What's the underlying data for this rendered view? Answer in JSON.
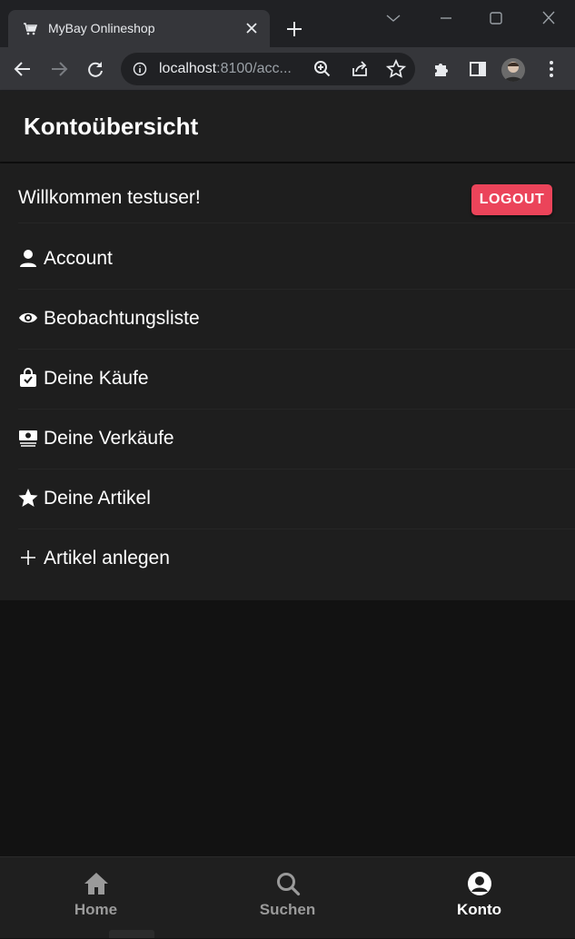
{
  "browser": {
    "tab_title": "MyBay Onlineshop",
    "url_host": "localhost",
    "url_rest": ":8100/acc...",
    "icons": [
      "cart-icon",
      "close-icon",
      "plus-icon",
      "back-icon",
      "forward-icon",
      "reload-icon",
      "info-icon",
      "zoom-icon",
      "share-icon",
      "star-icon",
      "puzzle-icon",
      "sidepanel-icon",
      "menu-dots-icon"
    ]
  },
  "header": {
    "title": "Kontoübersicht"
  },
  "welcome": {
    "text": "Willkommen testuser!",
    "logout_label": "LOGOUT"
  },
  "menu": {
    "items": [
      {
        "label": "Account",
        "icon": "person-icon"
      },
      {
        "label": "Beobachtungsliste",
        "icon": "eye-icon"
      },
      {
        "label": "Deine Käufe",
        "icon": "bag-check-icon"
      },
      {
        "label": "Deine Verkäufe",
        "icon": "cash-icon"
      },
      {
        "label": "Deine Artikel",
        "icon": "star-icon"
      },
      {
        "label": "Artikel anlegen",
        "icon": "add-icon"
      }
    ]
  },
  "tabbar": {
    "tabs": [
      {
        "label": "Home",
        "icon": "home-icon",
        "active": false
      },
      {
        "label": "Suchen",
        "icon": "search-icon",
        "active": false
      },
      {
        "label": "Konto",
        "icon": "person-circle-icon",
        "active": true
      }
    ]
  },
  "colors": {
    "accent": "#eb445a",
    "background": "#121212",
    "surface": "#1e1e1e"
  }
}
